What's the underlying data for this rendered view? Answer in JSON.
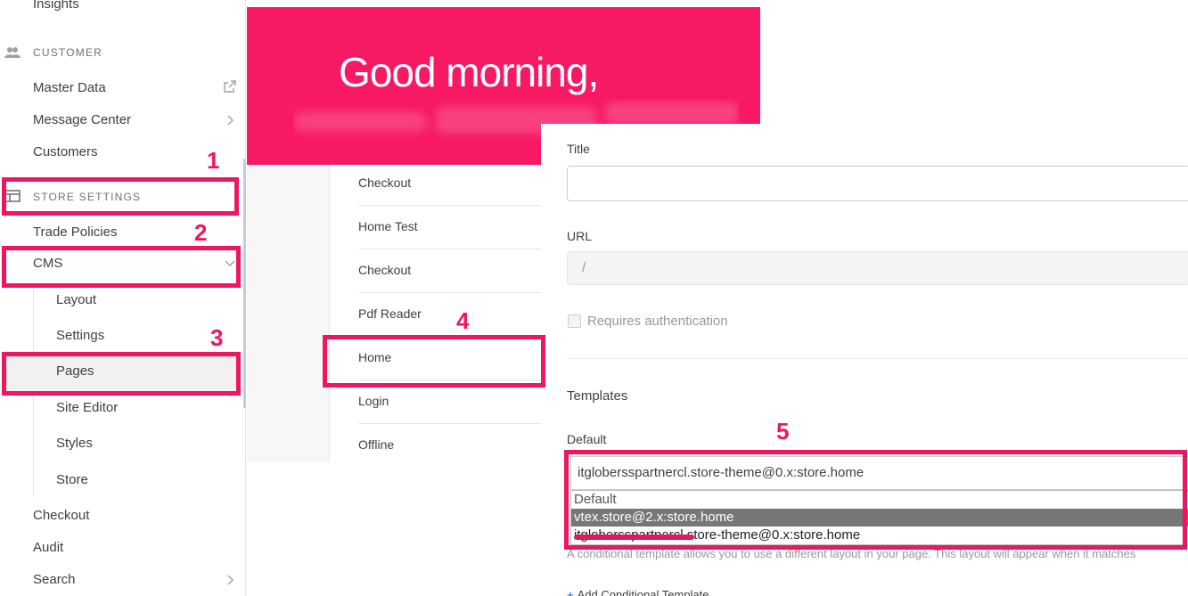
{
  "sidebar": {
    "insights_label": "Insights",
    "customer_section": "CUSTOMER",
    "master_data": "Master Data",
    "message_center": "Message Center",
    "customers": "Customers",
    "store_settings_section": "STORE SETTINGS",
    "trade_policies": "Trade Policies",
    "cms": "CMS",
    "cms_children": [
      "Layout",
      "Settings",
      "Pages",
      "Site Editor",
      "Styles",
      "Store"
    ],
    "checkout": "Checkout",
    "audit": "Audit",
    "search": "Search"
  },
  "hero": {
    "greeting": "Good morning,"
  },
  "page_list": {
    "items": [
      "Checkout",
      "Home Test",
      "Checkout",
      "Pdf Reader",
      "Home",
      "Login",
      "Offline"
    ]
  },
  "form": {
    "title_label": "Title",
    "title_value": "",
    "url_label": "URL",
    "url_value": "/",
    "requires_auth_label": "Requires authentication",
    "templates_heading": "Templates",
    "default_label": "Default",
    "default_value": "itglobersspartnercl.store-theme@0.x:store.home",
    "dropdown_options": [
      "Default",
      "vtex.store@2.x:store.home",
      "itglobersspartnercl.store-theme@0.x:store.home"
    ],
    "help_text": "A conditional template allows you to use a different layout in your page. This layout will appear when it matches",
    "add_conditional": "Add Conditional Template"
  },
  "annotations": [
    "1",
    "2",
    "3",
    "4",
    "5"
  ],
  "colors": {
    "brand": "#f71963",
    "annotation": "#f0155f"
  }
}
